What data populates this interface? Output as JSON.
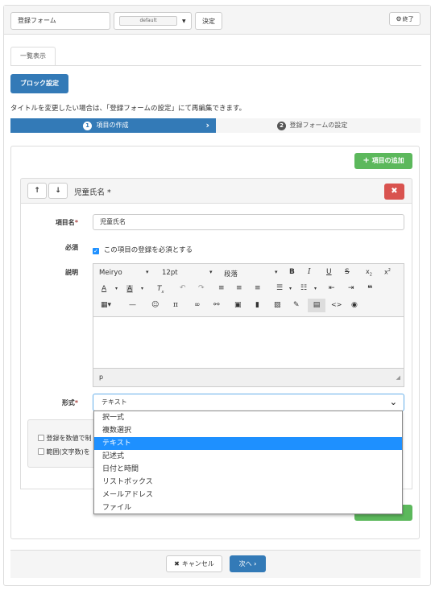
{
  "header": {
    "form_title": "登録フォーム",
    "default_label": "default",
    "decide_label": "決定",
    "end_label": "終了"
  },
  "tabs": {
    "list": "一覧表示"
  },
  "block_settings": "ブロック設定",
  "notice": "タイトルを変更したい場合は、「登録フォームの設定」にて再編集できます。",
  "steps": [
    {
      "num": "1",
      "label": "項目の作成"
    },
    {
      "num": "2",
      "label": "登録フォームの設定"
    }
  ],
  "add_item": "項目の追加",
  "item": {
    "title": "児童氏名",
    "required_mark": "*",
    "name_label": "項目名",
    "name_value": "児童氏名",
    "required_label": "必須",
    "required_text": "この項目の登録を必須とする",
    "desc_label": "説明",
    "format_label": "形式",
    "format_value": "テキスト"
  },
  "editor": {
    "font": "Meiryo",
    "size": "12pt",
    "paragraph": "段落",
    "status": "p"
  },
  "dropdown": {
    "options": [
      "択一式",
      "複数選択",
      "テキスト",
      "記述式",
      "日付と時間",
      "リストボックス",
      "メールアドレス",
      "ファイル"
    ],
    "selected_index": 2
  },
  "options_box": {
    "opt1": "登録を数値で制",
    "opt2": "範囲(文字数)を"
  },
  "footer": {
    "cancel": "キャンセル",
    "next": "次へ"
  },
  "colors": {
    "primary": "#337ab7",
    "success": "#5cb85c",
    "danger": "#d9534f",
    "highlight": "#1e90ff"
  }
}
